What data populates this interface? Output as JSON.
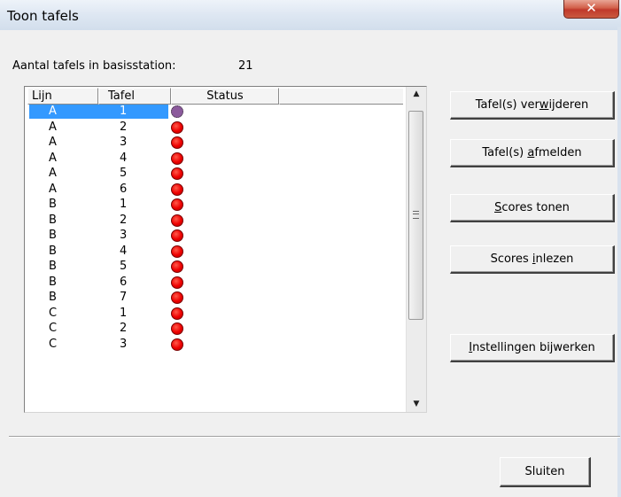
{
  "window": {
    "title": "Toon tafels",
    "close_glyph": "✕"
  },
  "summary": {
    "label": "Aantal tafels in basisstation:",
    "value": "21"
  },
  "table": {
    "headers": {
      "lijn": "Lijn",
      "tafel": "Tafel",
      "status": "Status"
    },
    "rows": [
      {
        "lijn": "A",
        "tafel": "1",
        "status_color": "#8b5a9c",
        "selected": true
      },
      {
        "lijn": "A",
        "tafel": "2",
        "status_color": "#ee0000"
      },
      {
        "lijn": "A",
        "tafel": "3",
        "status_color": "#ee0000"
      },
      {
        "lijn": "A",
        "tafel": "4",
        "status_color": "#ee0000"
      },
      {
        "lijn": "A",
        "tafel": "5",
        "status_color": "#ee0000"
      },
      {
        "lijn": "A",
        "tafel": "6",
        "status_color": "#ee0000"
      },
      {
        "lijn": "B",
        "tafel": "1",
        "status_color": "#ee0000"
      },
      {
        "lijn": "B",
        "tafel": "2",
        "status_color": "#ee0000"
      },
      {
        "lijn": "B",
        "tafel": "3",
        "status_color": "#ee0000"
      },
      {
        "lijn": "B",
        "tafel": "4",
        "status_color": "#ee0000"
      },
      {
        "lijn": "B",
        "tafel": "5",
        "status_color": "#ee0000"
      },
      {
        "lijn": "B",
        "tafel": "6",
        "status_color": "#ee0000"
      },
      {
        "lijn": "B",
        "tafel": "7",
        "status_color": "#ee0000"
      },
      {
        "lijn": "C",
        "tafel": "1",
        "status_color": "#ee0000"
      },
      {
        "lijn": "C",
        "tafel": "2",
        "status_color": "#ee0000"
      },
      {
        "lijn": "C",
        "tafel": "3",
        "status_color": "#ee0000"
      }
    ],
    "scroll_up_icon": "▲",
    "scroll_down_icon": "▼"
  },
  "buttons": {
    "verwijderen": {
      "pre": "Tafel(s) ver",
      "mnemonic": "w",
      "post": "ijderen"
    },
    "afmelden": {
      "pre": "Tafel(s) ",
      "mnemonic": "a",
      "post": "fmelden"
    },
    "scores": {
      "pre": "",
      "mnemonic": "S",
      "post": "cores tonen"
    },
    "inlezen": {
      "pre": "Scores ",
      "mnemonic": "i",
      "post": "nlezen"
    },
    "instellingen": {
      "pre": "",
      "mnemonic": "I",
      "post": "nstellingen bijwerken"
    },
    "sluiten": {
      "label": "Sluiten"
    }
  }
}
